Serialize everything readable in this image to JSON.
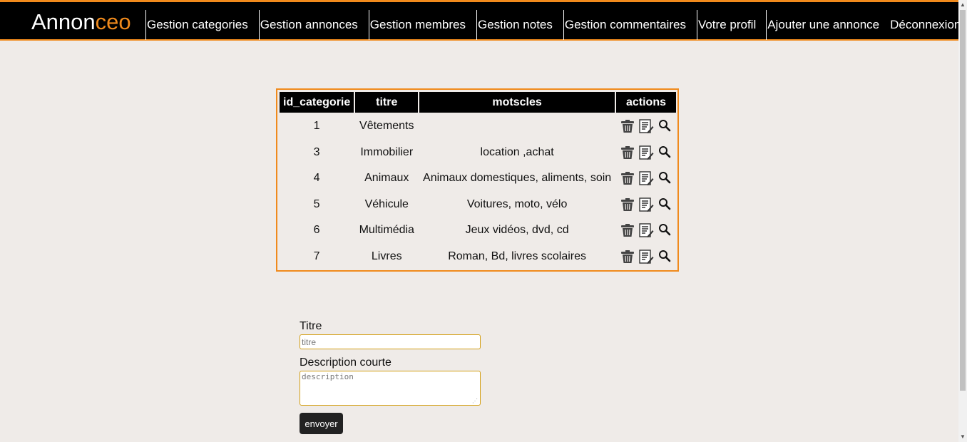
{
  "header": {
    "logo_main": "Annon",
    "logo_accent": "ceo",
    "nav": [
      "Gestion categories",
      "Gestion annonces",
      "Gestion membres",
      "Gestion notes",
      "Gestion commentaires",
      "Votre profil",
      "Ajouter une annonce",
      "Déconnexion"
    ]
  },
  "table": {
    "columns": [
      "id_categorie",
      "titre",
      "motscles",
      "actions"
    ],
    "rows": [
      {
        "id": "1",
        "titre": "Vêtements",
        "motscles": ""
      },
      {
        "id": "3",
        "titre": "Immobilier",
        "motscles": "location ,achat"
      },
      {
        "id": "4",
        "titre": "Animaux",
        "motscles": "Animaux domestiques, aliments, soin"
      },
      {
        "id": "5",
        "titre": "Véhicule",
        "motscles": "Voitures, moto, vélo"
      },
      {
        "id": "6",
        "titre": "Multimédia",
        "motscles": "Jeux vidéos, dvd, cd"
      },
      {
        "id": "7",
        "titre": "Livres",
        "motscles": "Roman, Bd, livres scolaires"
      }
    ],
    "row_actions": [
      "trash-icon",
      "edit-icon",
      "magnifier-icon"
    ]
  },
  "form": {
    "titre_label": "Titre",
    "titre_placeholder": "titre",
    "titre_value": "",
    "description_label": "Description courte",
    "description_placeholder": "description",
    "description_value": "",
    "submit_label": "envoyer"
  },
  "colors": {
    "accent": "#f08a1c",
    "header_bg": "#000000",
    "page_bg": "#efebe8",
    "button_bg": "#222222"
  }
}
